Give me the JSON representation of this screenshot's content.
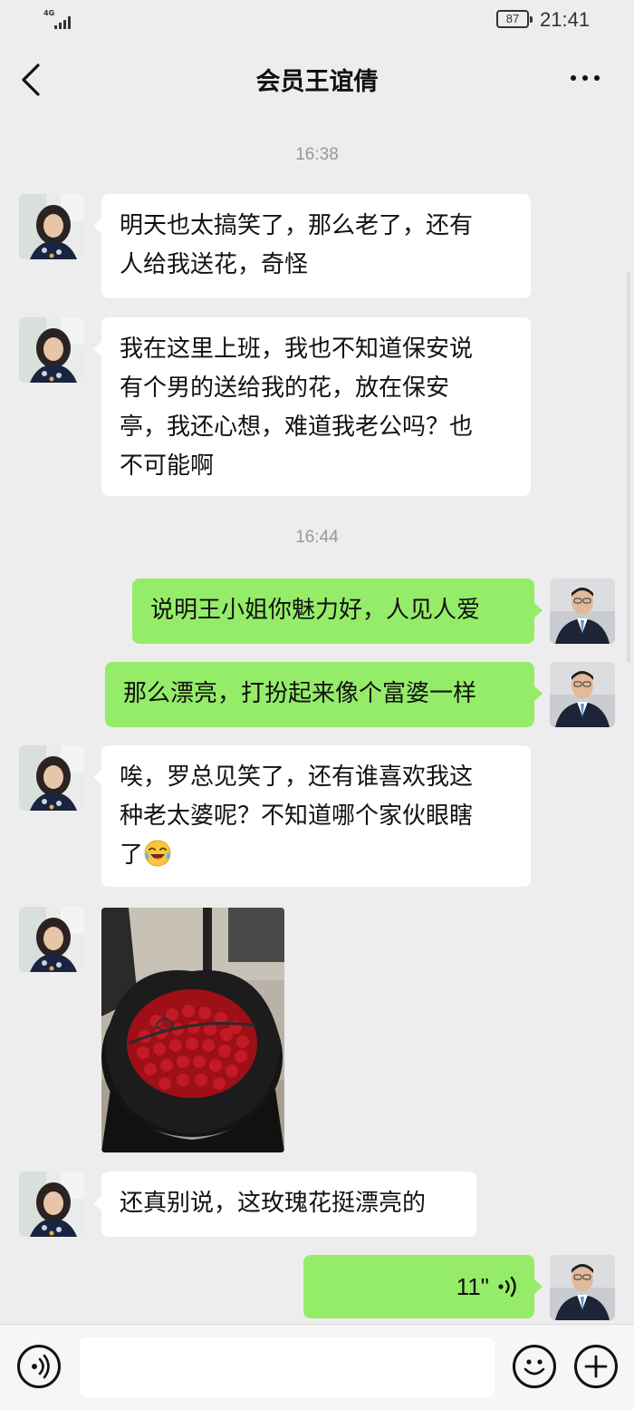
{
  "status_bar": {
    "network": "4G",
    "battery": "87",
    "time": "21:41"
  },
  "header": {
    "title": "会员王谊倩"
  },
  "chat": {
    "times": [
      "16:38",
      "16:44"
    ],
    "messages": [
      {
        "side": "in",
        "text_lines": [
          "明天也太搞笑了，那么老了，还有",
          "人给我送花，奇怪"
        ]
      },
      {
        "side": "in",
        "text_lines": [
          "我在这里上班，我也不知道保安说",
          "有个男的送给我的花，放在保安",
          "亭，我还心想，难道我老公吗？也",
          "不可能啊"
        ]
      },
      {
        "side": "out",
        "text": "说明王小姐你魅力好，人见人爱"
      },
      {
        "side": "out",
        "text": "那么漂亮，打扮起来像个富婆一样"
      },
      {
        "side": "in",
        "text_lines": [
          "唉，罗总见笑了，还有谁喜欢我这",
          "种老太婆呢？不知道哪个家伙眼瞎",
          "了"
        ],
        "emoji": "laughing-crying-emoji"
      },
      {
        "side": "in",
        "type": "image",
        "image_desc": "bouquet of red roses wrapped in black paper"
      },
      {
        "side": "in",
        "text": "还真别说，这玫瑰花挺漂亮的"
      },
      {
        "side": "out",
        "type": "voice",
        "duration": "11\""
      }
    ]
  },
  "input_bar": {
    "placeholder": ""
  },
  "icons": {
    "back": "chevron-left-icon",
    "more": "more-icon",
    "voice_toggle": "voice-icon",
    "emoji": "emoji-icon",
    "add": "plus-icon"
  },
  "colors": {
    "background": "#ededed",
    "outgoing_bubble": "#95ec69",
    "incoming_bubble": "#ffffff",
    "time_text": "#999999"
  }
}
